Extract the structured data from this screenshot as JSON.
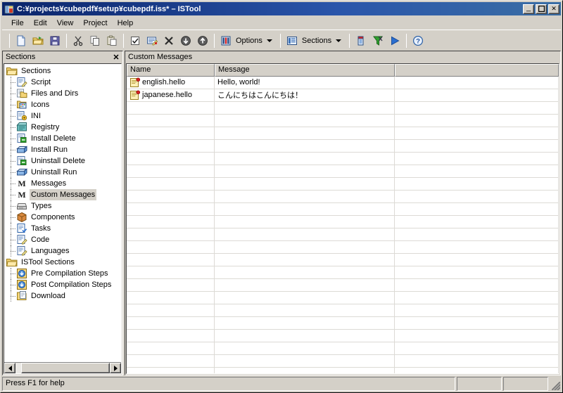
{
  "window": {
    "title": "C:¥projects¥cubepdf¥setup¥cubepdf.iss* – ISTool",
    "app_icon": "istool-icon",
    "minimize_label": "_",
    "maximize_label": "❐",
    "close_label": "✕"
  },
  "menubar": {
    "items": [
      {
        "label": "File"
      },
      {
        "label": "Edit"
      },
      {
        "label": "View"
      },
      {
        "label": "Project"
      },
      {
        "label": "Help"
      }
    ]
  },
  "toolbar": {
    "buttons": [
      {
        "name": "new-file-button",
        "icon": "new-file-icon"
      },
      {
        "name": "open-file-button",
        "icon": "open-folder-icon"
      },
      {
        "name": "save-file-button",
        "icon": "save-disk-icon"
      },
      {
        "name": "cut-button",
        "icon": "scissors-icon"
      },
      {
        "name": "copy-button",
        "icon": "copy-icon"
      },
      {
        "name": "paste-button",
        "icon": "paste-icon"
      },
      {
        "name": "check-button",
        "icon": "checkbox-icon"
      },
      {
        "name": "edit-entry-button",
        "icon": "edit-pencil-icon"
      },
      {
        "name": "delete-entry-button",
        "icon": "delete-x-icon"
      },
      {
        "name": "move-down-button",
        "icon": "arrow-down-circle-icon"
      },
      {
        "name": "move-up-button",
        "icon": "arrow-up-circle-icon"
      }
    ],
    "options_label": "Options",
    "options_icon": "options-icon",
    "sections_label": "Sections",
    "sections_icon": "sections-list-icon",
    "compile_buttons": [
      {
        "name": "compile-setup-button",
        "icon": "compile-icon"
      },
      {
        "name": "compile-and-clean-button",
        "icon": "compile-clean-icon"
      },
      {
        "name": "run-setup-button",
        "icon": "run-play-icon"
      }
    ],
    "help_label": "?",
    "help_icon": "help-question-icon"
  },
  "sections_panel": {
    "caption": "Sections",
    "close_label": "✕",
    "tree": [
      {
        "label": "Sections",
        "icon": "folder-open-icon",
        "level": 0,
        "selected": false
      },
      {
        "label": "Script",
        "icon": "script-icon",
        "level": 1,
        "selected": false
      },
      {
        "label": "Files and Dirs",
        "icon": "files-icon",
        "level": 1,
        "selected": false
      },
      {
        "label": "Icons",
        "icon": "icons-icon",
        "level": 1,
        "selected": false
      },
      {
        "label": "INI",
        "icon": "ini-icon",
        "level": 1,
        "selected": false
      },
      {
        "label": "Registry",
        "icon": "registry-icon",
        "level": 1,
        "selected": false
      },
      {
        "label": "Install Delete",
        "icon": "install-delete-icon",
        "level": 1,
        "selected": false
      },
      {
        "label": "Install Run",
        "icon": "install-run-icon",
        "level": 1,
        "selected": false
      },
      {
        "label": "Uninstall Delete",
        "icon": "uninstall-delete-icon",
        "level": 1,
        "selected": false
      },
      {
        "label": "Uninstall Run",
        "icon": "uninstall-run-icon",
        "level": 1,
        "selected": false
      },
      {
        "label": "Messages",
        "icon": "messages-icon",
        "level": 1,
        "selected": false
      },
      {
        "label": "Custom Messages",
        "icon": "custom-messages-icon",
        "level": 1,
        "selected": true
      },
      {
        "label": "Types",
        "icon": "types-icon",
        "level": 1,
        "selected": false
      },
      {
        "label": "Components",
        "icon": "components-icon",
        "level": 1,
        "selected": false
      },
      {
        "label": "Tasks",
        "icon": "tasks-icon",
        "level": 1,
        "selected": false
      },
      {
        "label": "Code",
        "icon": "code-icon",
        "level": 1,
        "selected": false
      },
      {
        "label": "Languages",
        "icon": "languages-icon",
        "level": 1,
        "selected": false
      },
      {
        "label": "ISTool Sections",
        "icon": "folder-open-icon",
        "level": 0,
        "selected": false
      },
      {
        "label": "Pre Compilation Steps",
        "icon": "pre-compile-icon",
        "level": 1,
        "selected": false
      },
      {
        "label": "Post Compilation Steps",
        "icon": "post-compile-icon",
        "level": 1,
        "selected": false
      },
      {
        "label": "Download",
        "icon": "download-icon",
        "level": 1,
        "selected": false
      }
    ]
  },
  "list_panel": {
    "caption": "Custom Messages",
    "columns": [
      {
        "label": "Name"
      },
      {
        "label": "Message"
      },
      {
        "label": ""
      }
    ],
    "rows": [
      {
        "icon": "message-entry-icon",
        "name": "english.hello",
        "message": "Hello, world!",
        "extra": ""
      },
      {
        "icon": "message-entry-icon",
        "name": "japanese.hello",
        "message": "こんにちはこんにちは！",
        "extra": ""
      }
    ],
    "empty_row_count": 22
  },
  "statusbar": {
    "hint": "Press F1 for help",
    "panel2": "",
    "panel3": ""
  },
  "colors": {
    "title_active_start": "#0a246a",
    "title_active_end": "#3a6ea5",
    "face": "#d4d0c8",
    "selection": "#d4d0c8",
    "grid_line": "#dcdad5"
  }
}
